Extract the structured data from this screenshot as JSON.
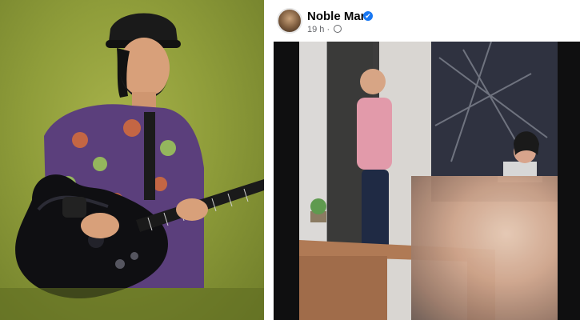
{
  "post": {
    "author_name": "Noble Man",
    "timestamp": "19 h",
    "separator": "·",
    "verified_badge": "✔"
  },
  "icons": {
    "verified": "verified-badge-icon",
    "audience": "globe-icon"
  },
  "colors": {
    "facebook_blue": "#1877f2",
    "meta_gray": "#65676b"
  }
}
